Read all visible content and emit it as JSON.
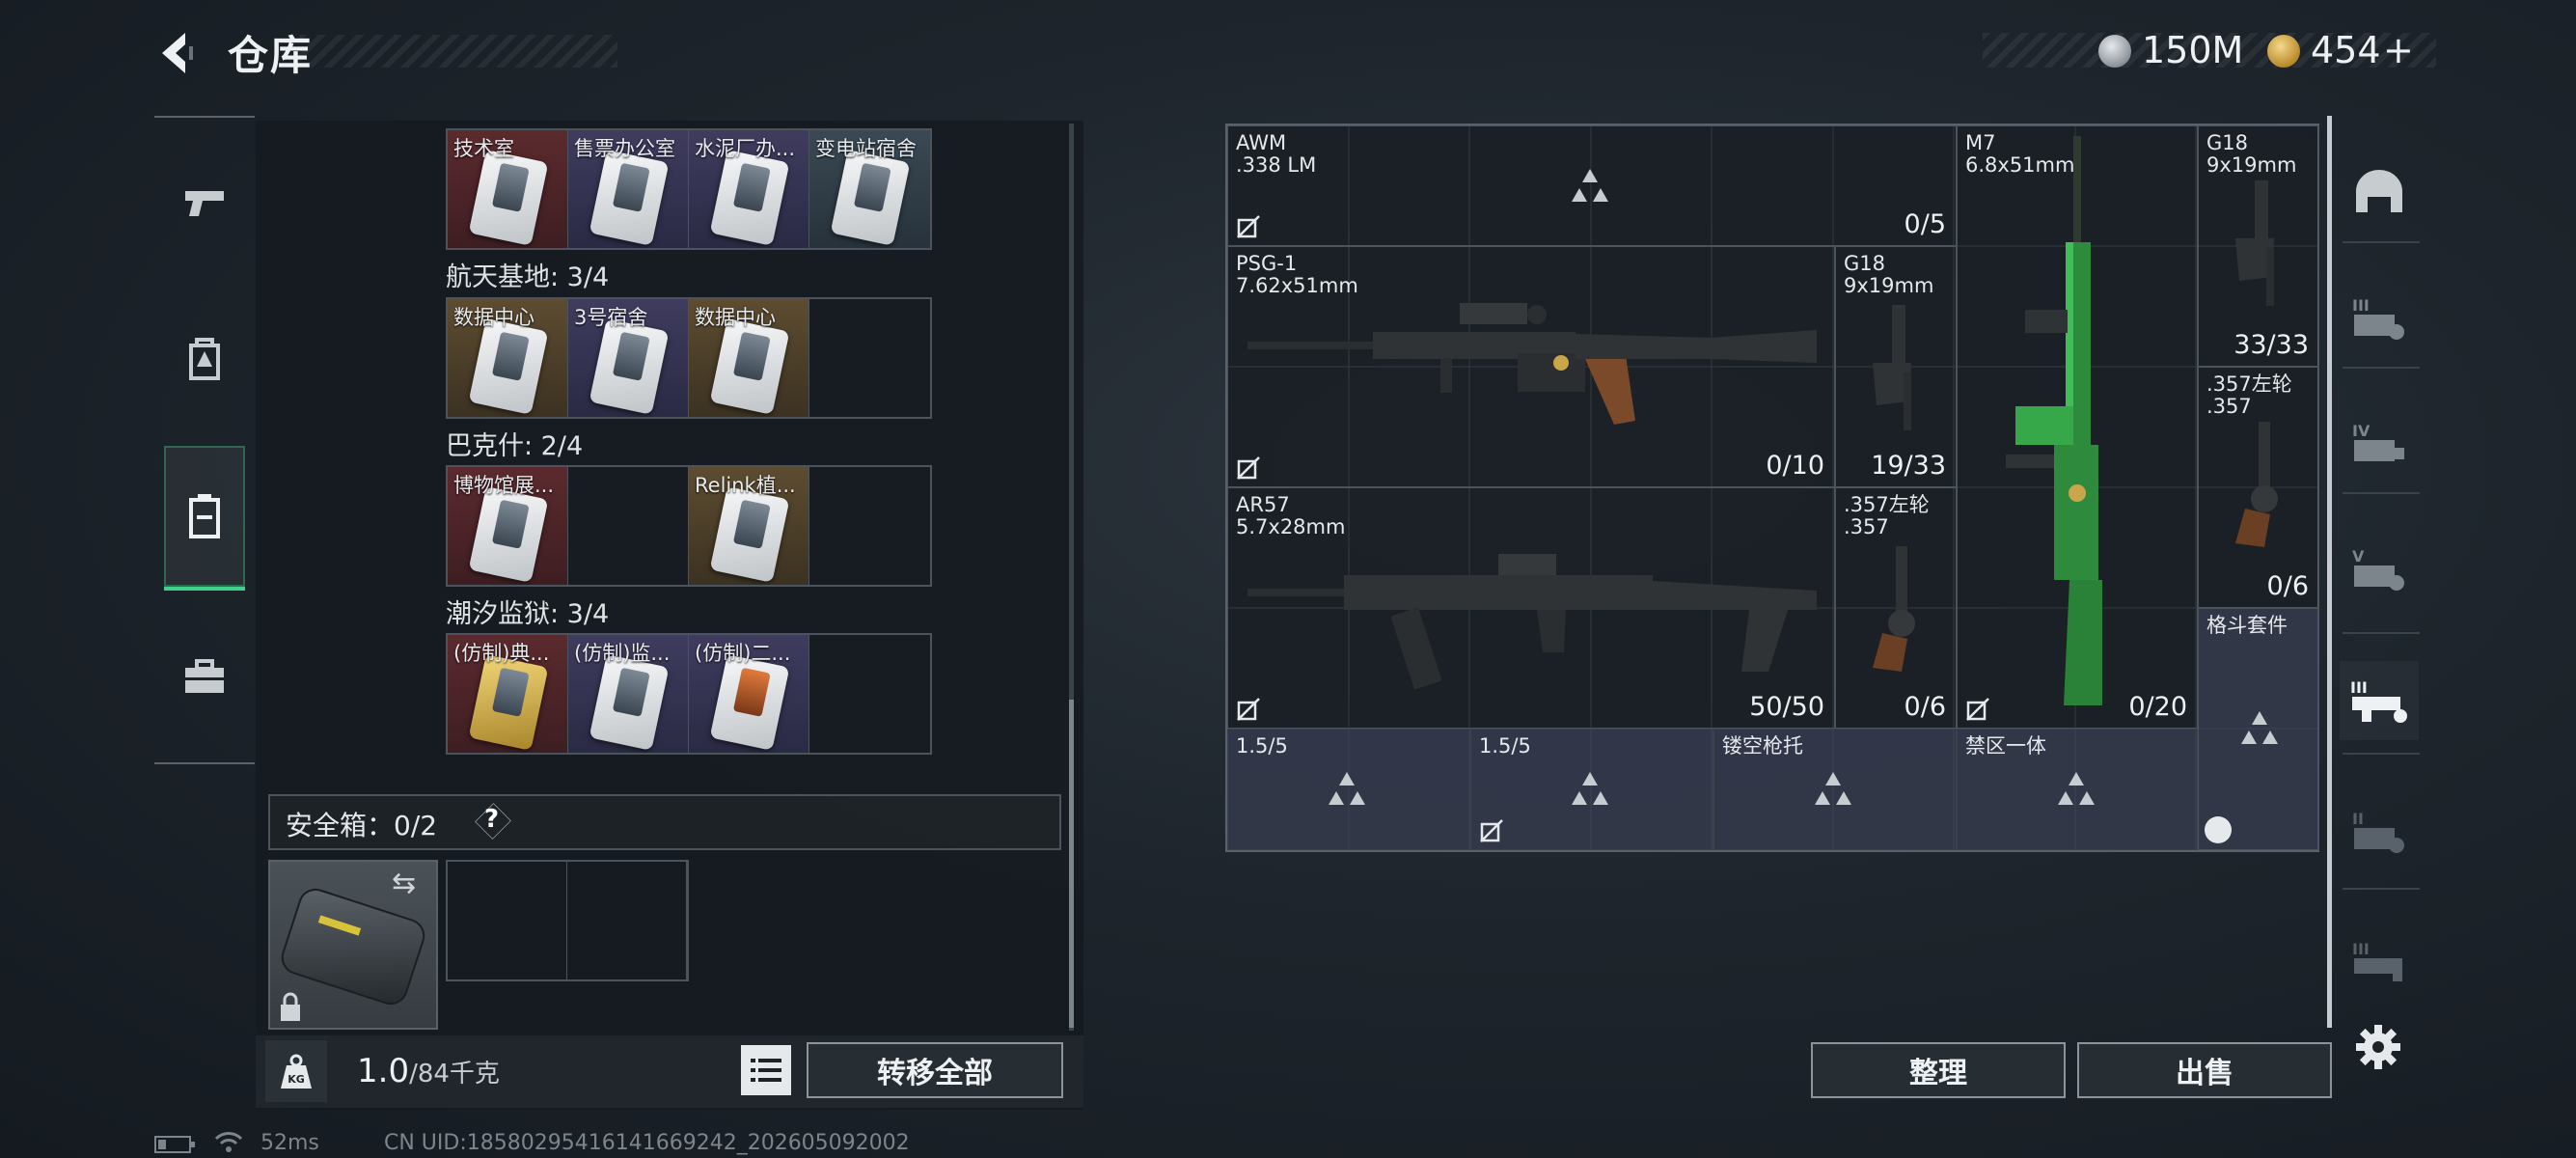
{
  "header": {
    "title": "仓库",
    "currency_silver": "150M",
    "currency_gold": "454",
    "currency_gold_plus": "+"
  },
  "left_nav": [
    "pistol-icon",
    "backpack-icon",
    "storage-case-icon",
    "briefcase-icon"
  ],
  "keycards": {
    "rows": [
      {
        "label": "",
        "slots": [
          {
            "name": "技术室",
            "rarity": "red"
          },
          {
            "name": "售票办公室",
            "rarity": "purple"
          },
          {
            "name": "水泥厂办...",
            "rarity": "purple"
          },
          {
            "name": "变电站宿舍",
            "rarity": "blue"
          }
        ]
      },
      {
        "label": "航天基地: 3/4",
        "slots": [
          {
            "name": "数据中心",
            "rarity": "gold"
          },
          {
            "name": "3号宿舍",
            "rarity": "purple"
          },
          {
            "name": "数据中心",
            "rarity": "gold"
          },
          {
            "name": "",
            "rarity": "empty"
          }
        ]
      },
      {
        "label": "巴克什: 2/4",
        "slots": [
          {
            "name": "博物馆展...",
            "rarity": "red"
          },
          {
            "name": "",
            "rarity": "empty"
          },
          {
            "name": "Relink植...",
            "rarity": "gold"
          },
          {
            "name": "",
            "rarity": "empty"
          }
        ]
      },
      {
        "label": "潮汐监狱: 3/4",
        "slots": [
          {
            "name": "(仿制)典...",
            "rarity": "red"
          },
          {
            "name": "(仿制)监...",
            "rarity": "purple"
          },
          {
            "name": "(仿制)二...",
            "rarity": "purple"
          },
          {
            "name": "",
            "rarity": "empty"
          }
        ]
      }
    ]
  },
  "safe_box": {
    "label": "安全箱：0/2",
    "help": "?"
  },
  "footer": {
    "weight_value": "1.0",
    "weight_capacity": "/84千克",
    "weight_icon_text": "KG",
    "transfer_all": "转移全部"
  },
  "status": {
    "ping": "52ms",
    "uid": "CN UID:18580295416141669242_202605092002"
  },
  "weapons": {
    "awm": {
      "name": "AWM",
      "ammo": ".338 LM",
      "count": "0/5"
    },
    "psg1": {
      "name": "PSG-1",
      "ammo": "7.62x51mm",
      "count": "0/10"
    },
    "g18a": {
      "name": "G18",
      "ammo": "9x19mm",
      "count": "19/33"
    },
    "ar57": {
      "name": "AR57",
      "ammo": "5.7x28mm",
      "count": "50/50"
    },
    "rev_a": {
      "name": ".357左轮",
      "ammo": ".357",
      "count": "0/6"
    },
    "m7": {
      "name": "M7",
      "ammo": "6.8x51mm",
      "count": "0/20"
    },
    "g18b": {
      "name": "G18",
      "ammo": "9x19mm",
      "count": "33/33"
    },
    "rev_b": {
      "name": ".357左轮",
      "ammo": ".357",
      "count": "0/6"
    },
    "melee": {
      "name": "格斗套件"
    }
  },
  "attachments": [
    "1.5/5",
    "1.5/5",
    "镂空枪托",
    "禁区一体"
  ],
  "actions": {
    "sort": "整理",
    "sell": "出售"
  },
  "right_nav": [
    "helmet-icon",
    "tier3-armor-icon",
    "tier4-armor-icon",
    "tier5-armor-icon",
    "tier3-gun-icon",
    "tier2-armor-icon",
    "tier3-armor-icon"
  ],
  "colors": {
    "accent_green": "#3fd08a",
    "rarity_red": "#5b2a2e",
    "rarity_purple": "#3f3c5e",
    "rarity_gold": "#5d4c30"
  }
}
